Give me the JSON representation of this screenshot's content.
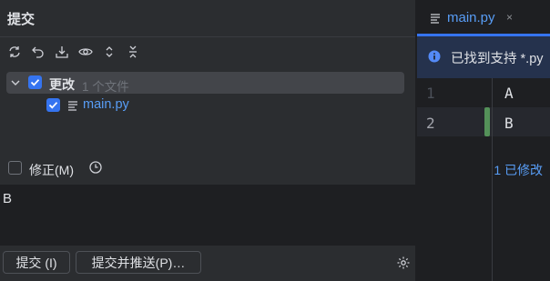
{
  "commit_panel": {
    "title": "提交",
    "toolbar": [
      "refresh-icon",
      "rollback-icon",
      "shelve-icon",
      "eye-icon",
      "expand-all-icon",
      "collapse-all-icon"
    ],
    "changes_group": {
      "label": "更改",
      "count": "1 个文件",
      "checked": true
    },
    "files": [
      {
        "name": "main.py",
        "checked": true
      }
    ],
    "amend": {
      "label": "修正(M)",
      "checked": false
    },
    "modified_count": "1 已修改",
    "message": "B",
    "buttons": {
      "commit": "提交 (I)",
      "commit_push": "提交并推送(P)…"
    }
  },
  "editor": {
    "tab": {
      "label": "main.py",
      "close": "×"
    },
    "banner": "已找到支持 *.py",
    "lines": [
      {
        "number": "1",
        "text": "A"
      },
      {
        "number": "2",
        "text": "B"
      }
    ]
  },
  "colors": {
    "accent": "#3574f0",
    "link_blue": "#589df6",
    "panel_bg": "#2b2d30",
    "editor_bg": "#1e1f22",
    "banner_bg": "#25324d",
    "change_marker": "#549159"
  }
}
